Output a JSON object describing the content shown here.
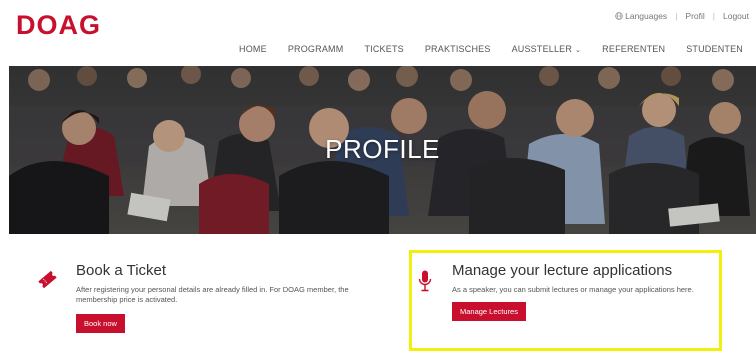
{
  "brand": {
    "logo_text": "DOAG",
    "accent": "#c8102e"
  },
  "toplinks": {
    "languages": "Languages",
    "profile": "Profil",
    "logout": "Logout"
  },
  "nav": {
    "items": [
      {
        "label": "HOME"
      },
      {
        "label": "PROGRAMM"
      },
      {
        "label": "TICKETS"
      },
      {
        "label": "PRAKTISCHES"
      },
      {
        "label": "AUSSTELLER",
        "has_dropdown": true
      },
      {
        "label": "REFERENTEN"
      },
      {
        "label": "STUDENTEN"
      }
    ]
  },
  "hero": {
    "title": "PROFILE"
  },
  "cards": {
    "ticket": {
      "title": "Book a Ticket",
      "text": "After registering your personal details are already filled in. For DOAG member, the membership price is activated.",
      "button": "Book now",
      "icon": "ticket-icon"
    },
    "lecture": {
      "title": "Manage your lecture applications",
      "text": "As a speaker, you can submit lectures or manage your applications here.",
      "button": "Manage Lectures",
      "icon": "microphone-icon",
      "highlight_color": "#f4ee0c"
    }
  }
}
